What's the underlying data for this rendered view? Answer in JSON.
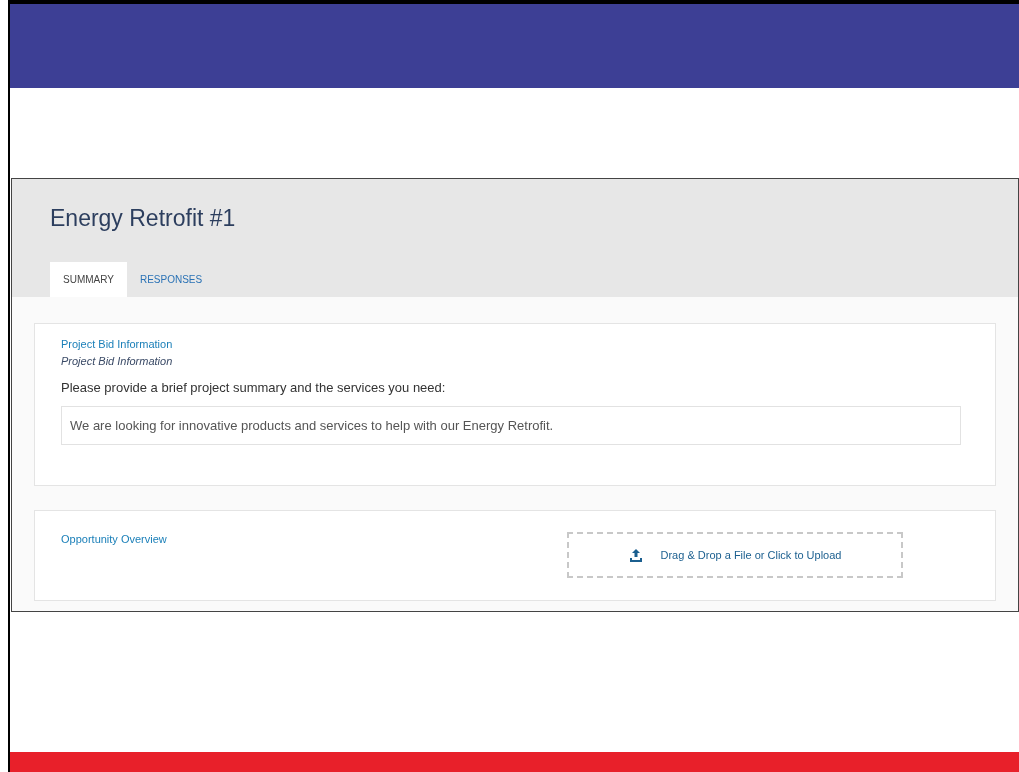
{
  "page_title": "Energy Retrofit #1",
  "tabs": [
    {
      "label": "SUMMARY",
      "selected": true
    },
    {
      "label": "RESPONSES",
      "selected": false
    }
  ],
  "sections": [
    {
      "kind": "text",
      "heading": "Project Bid Information",
      "subheading": "Project Bid Information",
      "question": "Please provide a brief project summary and the services you need:",
      "answer": "We are looking for innovative products and services to help with our Energy Retrofit."
    },
    {
      "kind": "upload",
      "heading": "Opportunity Overview",
      "upload_label": "Drag & Drop a File or Click to Upload"
    }
  ]
}
